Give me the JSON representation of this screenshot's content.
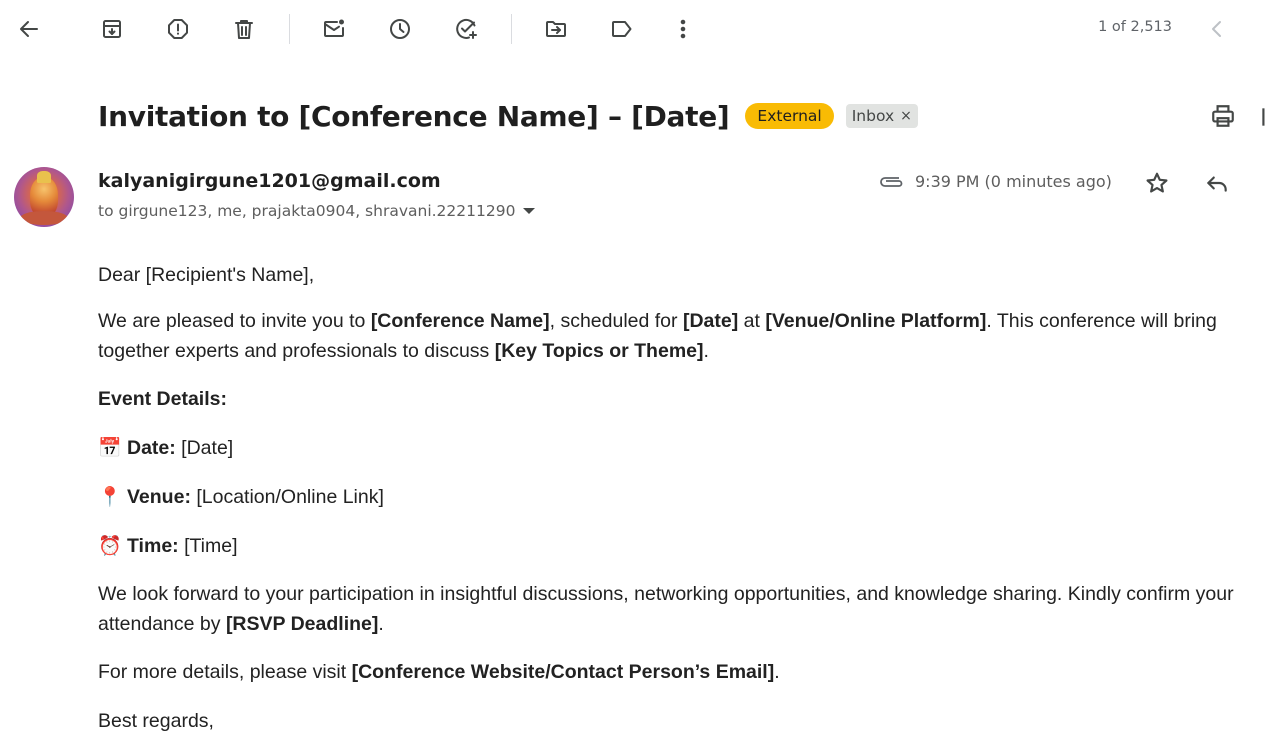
{
  "toolbar": {
    "pager": "1 of 2,513"
  },
  "email": {
    "subject": "Invitation to [Conference Name] – [Date]",
    "labels": {
      "external": "External",
      "inbox": "Inbox",
      "remove": "×"
    },
    "sender": "kalyanigirgune1201@gmail.com",
    "recipients": "to girgune123, me, prajakta0904, shravani.22211290",
    "timestamp": "9:39 PM (0 minutes ago)",
    "body": {
      "greeting": "Dear [Recipient's Name],",
      "intro_1": "We are pleased to invite you to ",
      "intro_conf": "[Conference Name]",
      "intro_2": ", scheduled for ",
      "intro_date": "[Date]",
      "intro_3": " at ",
      "intro_venue": "[Venue/Online Platform]",
      "intro_4": ". This conference will bring together experts and professionals to discuss ",
      "intro_topics": "[Key Topics or Theme]",
      "intro_5": ".",
      "details_heading": "Event Details:",
      "date_emoji": "📅",
      "date_label": "Date:",
      "date_value": " [Date]",
      "venue_emoji": "📍",
      "venue_label": "Venue:",
      "venue_value": " [Location/Online Link]",
      "time_emoji": "⏰",
      "time_label": "Time:",
      "time_value": " [Time]",
      "look_1": "We look forward to your participation in insightful discussions, networking opportunities, and knowledge sharing. Kindly confirm your attendance by ",
      "look_rsvp": "[RSVP Deadline]",
      "look_2": ".",
      "more_1": "For more details, please visit ",
      "more_link": "[Conference Website/Contact Person’s Email]",
      "more_2": ".",
      "regards": "Best regards,"
    }
  },
  "colors": {
    "external_badge": "#f9bb04",
    "inbox_badge": "#e1e3e1",
    "icon": "#444746",
    "text": "#1f1f1f",
    "muted": "#5e5e5e"
  },
  "icons": [
    "back-arrow-icon",
    "archive-icon",
    "report-spam-icon",
    "delete-icon",
    "mark-unread-icon",
    "snooze-icon",
    "add-task-icon",
    "move-to-icon",
    "label-icon",
    "more-vert-icon",
    "chevron-left-icon",
    "print-icon",
    "open-new-window-icon",
    "attachment-icon",
    "star-icon",
    "reply-icon"
  ]
}
